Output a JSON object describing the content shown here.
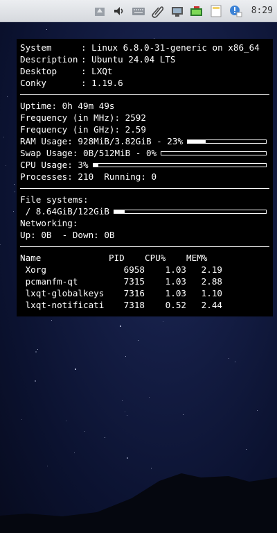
{
  "panel": {
    "clock": "8:29",
    "tray_icons": [
      "window-list-icon",
      "volume-icon",
      "keyboard-icon",
      "clipboard-icon",
      "network-icon",
      "battery-icon",
      "notes-icon",
      "notification-icon"
    ]
  },
  "conky": {
    "system": {
      "label": "System",
      "value": "Linux 6.8.0-31-generic on x86_64"
    },
    "description": {
      "label": "Description",
      "value": "Ubuntu 24.04 LTS"
    },
    "desktop": {
      "label": "Desktop",
      "value": "LXQt"
    },
    "conky_version": {
      "label": "Conky",
      "value": "1.19.6"
    },
    "uptime": "Uptime: 0h 49m 49s",
    "freq_mhz": "Frequency (in MHz): 2592",
    "freq_ghz": "Frequency (in GHz): 2.59",
    "ram": {
      "text": "RAM Usage: 928MiB/3.82GiB - 23%",
      "fraction": 0.23
    },
    "swap": {
      "text": "Swap Usage: 0B/512MiB - 0%",
      "fraction": 0.0
    },
    "cpu": {
      "text": "CPU Usage: 3%",
      "fraction": 0.03
    },
    "processes": "Processes: 210  Running: 0",
    "filesystems_title": "File systems:",
    "root_fs": {
      "text": " / 8.64GiB/122GiB",
      "fraction": 0.07
    },
    "networking_title": "Networking:",
    "net": "Up: 0B  - Down: 0B",
    "proc_headers": [
      "Name",
      "PID",
      "CPU%",
      "MEM%"
    ],
    "procs": [
      {
        "name": " Xorg",
        "pid": "6958",
        "cpu": "1.03",
        "mem": "2.19"
      },
      {
        "name": " pcmanfm-qt",
        "pid": "7315",
        "cpu": "1.03",
        "mem": "2.88"
      },
      {
        "name": " lxqt-globalkeys",
        "pid": "7316",
        "cpu": "1.03",
        "mem": "1.10"
      },
      {
        "name": " lxqt-notificati",
        "pid": "7318",
        "cpu": "0.52",
        "mem": "2.44"
      }
    ]
  }
}
